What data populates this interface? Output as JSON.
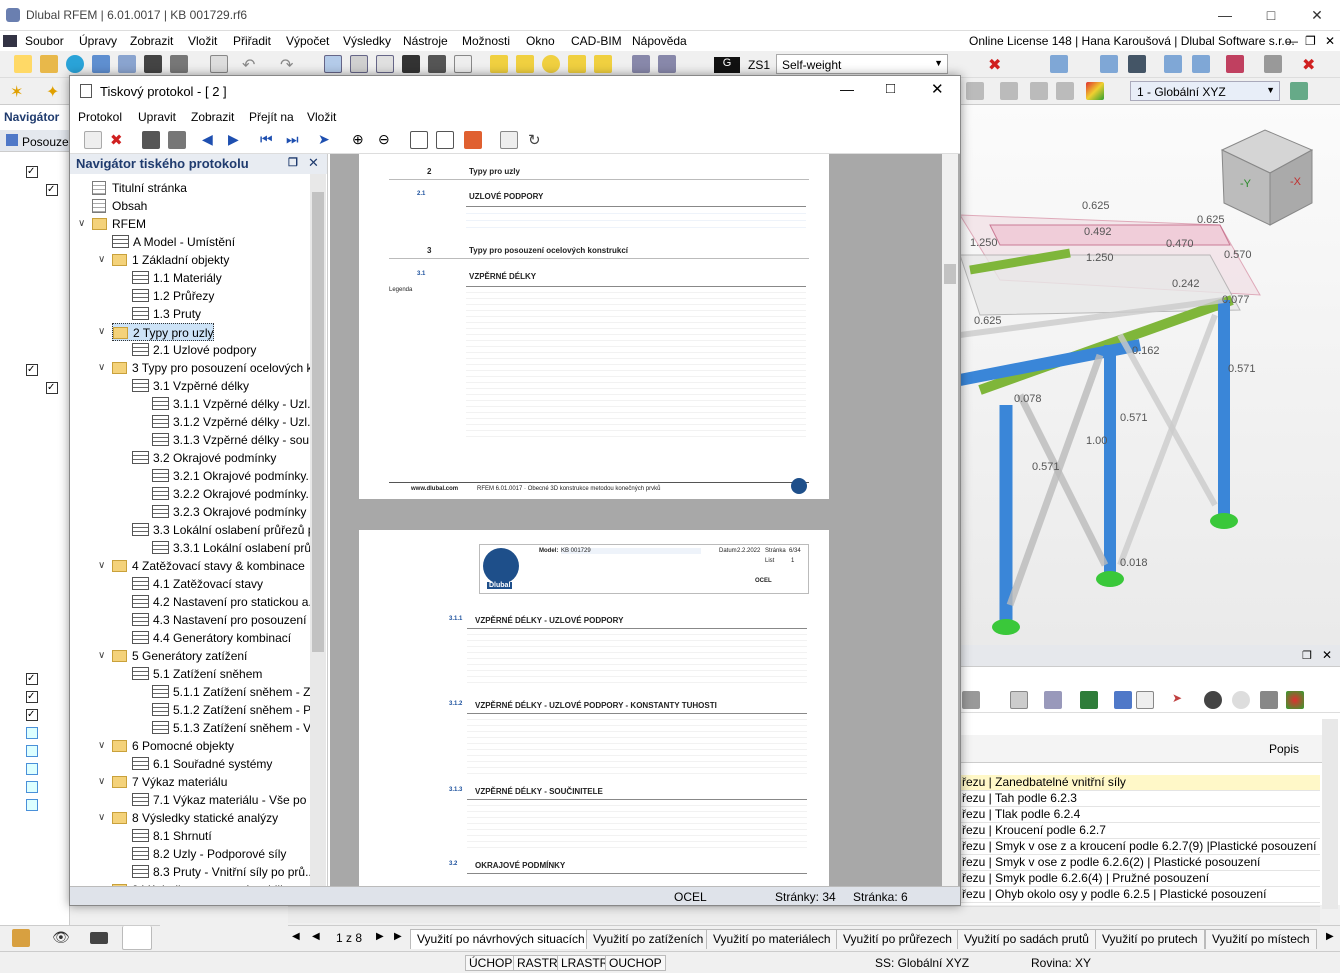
{
  "app": {
    "title": "Dlubal RFEM | 6.01.0017 | KB 001729.rf6",
    "license": "Online License 148 | Hana Karoušová | Dlubal Software s.r.o.",
    "menu": [
      "Soubor",
      "Úpravy",
      "Zobrazit",
      "Vložit",
      "Přiřadit",
      "Výpočet",
      "Výsledky",
      "Nástroje",
      "Možnosti",
      "Okno",
      "CAD-BIM",
      "Nápověda"
    ],
    "loadcase_code": "G",
    "loadcase_id": "ZS1",
    "loadcase_name": "Self-weight",
    "coord_system": "1 - Globální XYZ",
    "navigator_label": "Navigátor",
    "posouz_label": "Posouzení"
  },
  "report": {
    "title": "Tiskový protokol - [ 2 ]",
    "menu": [
      "Protokol",
      "Upravit",
      "Zobrazit",
      "Přejít na",
      "Vložit"
    ],
    "nav_title": "Navigátor tiského protokolu",
    "tree": [
      "Titulní stránka",
      "Obsah",
      "RFEM",
      "A Model - Umístění",
      "1 Základní objekty",
      "1.1 Materiály",
      "1.2 Průřezy",
      "1.3 Pruty",
      "2 Typy pro uzly",
      "2.1 Uzlové podpory",
      "3 Typy pro posouzení ocelových k...",
      "3.1 Vzpěrné délky",
      "3.1.1 Vzpěrné délky - Uzl...",
      "3.1.2 Vzpěrné délky - Uzl...",
      "3.1.3 Vzpěrné délky - sou...",
      "3.2 Okrajové podmínky",
      "3.2.1 Okrajové podmínky...",
      "3.2.2 Okrajové podmínky...",
      "3.2.3 Okrajové podmínky",
      "3.3 Lokální oslabení průřezů p...",
      "3.3.1 Lokální oslabení prů...",
      "4 Zatěžovací stavy & kombinace",
      "4.1 Zatěžovací stavy",
      "4.2 Nastavení pro statickou a...",
      "4.3 Nastavení pro posouzení ...",
      "4.4 Generátory kombinací",
      "5 Generátory zatížení",
      "5.1 Zatížení sněhem",
      "5.1.1 Zatížení sněhem - Z...",
      "5.1.2 Zatížení sněhem - P...",
      "5.1.3 Zatížení sněhem - V...",
      "6 Pomocné objekty",
      "6.1 Souřadné systémy",
      "7 Výkaz materiálu",
      "7.1 Výkaz materiálu - Vše po ...",
      "8 Výsledky statické analýzy",
      "8.1 Shrnutí",
      "8.2 Uzly - Podporové síly",
      "8.3 Pruty - Vnitřní síly po prů...",
      "9 Výsledky posouzení stability"
    ],
    "status_material": "OCEL",
    "status_pages": "Stránky: 34",
    "status_page": "Stránka: 6",
    "page1": {
      "sec2": "Typy pro uzly",
      "sec21": "UZLOVÉ PODPORY",
      "sec3": "Typy pro posouzení ocelových konstrukcí",
      "sec31": "VZPĚRNÉ DÉLKY",
      "legend": "Legenda",
      "footer_web": "www.dlubal.com",
      "footer_prog": "RFEM 6.01.0017 · Obecné 3D konstrukce metodou konečných prvků"
    },
    "page2": {
      "model_label": "Model:",
      "model_value": "KB 001729",
      "date_label": "Datum",
      "date_value": "2.2.2022",
      "page_label": "Stránka",
      "page_value": "6/34",
      "sheet_label": "List",
      "sheet_value": "1",
      "material": "OCEL",
      "logo": "Dlubal",
      "s1": "VZPĚRNÉ DÉLKY - UZLOVÉ PODPORY",
      "s2": "VZPĚRNÉ DÉLKY - UZLOVÉ PODPORY - KONSTANTY TUHOSTI",
      "s3": "VZPĚRNÉ DÉLKY - SOUČINITELE",
      "s4": "OKRAJOVÉ PODMÍNKY"
    }
  },
  "results": {
    "column": "Popis",
    "rows": [
      "řezu | Zanedbatelné vnitřní síly",
      "řezu | Tah podle 6.2.3",
      "řezu | Tlak podle 6.2.4",
      "řezu | Kroucení podle 6.2.7",
      "řezu | Smyk v ose z a kroucení podle 6.2.7(9) |Plastické posouzení",
      "řezu | Smyk v ose z podle 6.2.6(2) | Plastické posouzení",
      "řezu | Smyk podle 6.2.6(4) | Pružné posouzení",
      "řezu | Ohyb okolo osy y podle 6.2.5 | Plastické posouzení"
    ]
  },
  "view3d": {
    "labels": [
      "0.625",
      "0.625",
      "1.250",
      "0.492",
      "0.470",
      "0.570",
      "1.250",
      "0.242",
      "0.077",
      "0.625",
      "0.162",
      "0.571",
      "0.078",
      "0.571",
      "1.00",
      "0.571",
      "0.018"
    ]
  },
  "bottom_tabs": {
    "pager": "1 z 8",
    "tabs": [
      "Využití po návrhových situacích",
      "Využití po zatíženích",
      "Využití po materiálech",
      "Využití po průřezech",
      "Využití po sadách prutů",
      "Využití po prutech",
      "Využití po místech"
    ]
  },
  "statusbar": {
    "toggles": [
      "ÚCHOP",
      "RASTR",
      "LRASTR",
      "OUCHOP"
    ],
    "ss": "SS: Globální XYZ",
    "plane": "Rovina: XY"
  },
  "colors": {
    "member_blue": "#3a86d8",
    "member_green": "#7fb63a",
    "support_green": "#3ac83a",
    "load_pink": "#d0607a"
  }
}
